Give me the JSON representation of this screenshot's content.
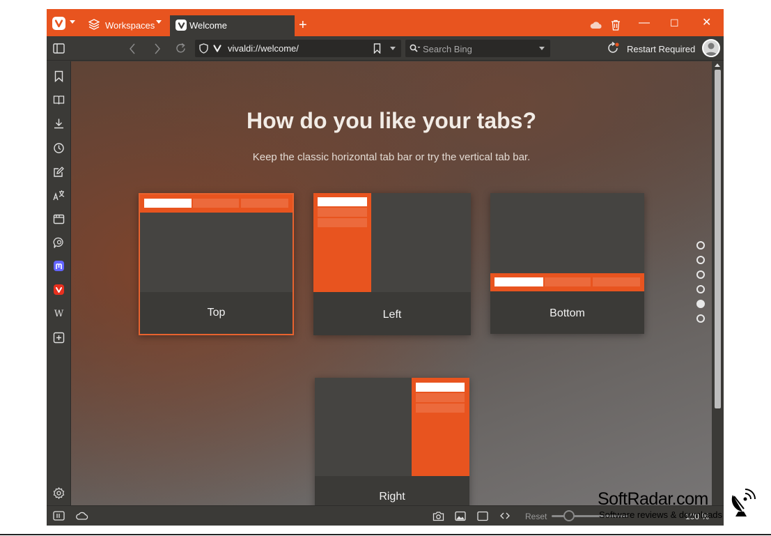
{
  "colors": {
    "accent": "#e8541f",
    "chrome": "#3b3a37",
    "tab_preview_white": "#ffffff"
  },
  "titlebar": {
    "workspaces_label": "Workspaces",
    "active_tab_label": "Welcome",
    "new_tab_symbol": "+",
    "controls": {
      "minimize": "—",
      "maximize": "☐",
      "close": "✕"
    }
  },
  "addressbar": {
    "url": "vivaldi://welcome/",
    "search_placeholder": "Search Bing",
    "restart_label": "Restart Required"
  },
  "sidepanel": {
    "icons": [
      "bookmark-icon",
      "reading-list-icon",
      "download-icon",
      "history-icon",
      "notes-icon",
      "translate-icon",
      "window-icon",
      "feed-icon",
      "mastodon-icon",
      "vivaldi-social-icon",
      "wikipedia-icon",
      "add-panel-icon"
    ],
    "wikipedia_glyph": "W"
  },
  "welcome": {
    "heading": "How do you like your tabs?",
    "subheading": "Keep the classic horizontal tab bar or try the vertical tab bar.",
    "options": [
      {
        "id": "top",
        "label": "Top",
        "selected": true
      },
      {
        "id": "left",
        "label": "Left",
        "selected": false
      },
      {
        "id": "bottom",
        "label": "Bottom",
        "selected": false
      },
      {
        "id": "right",
        "label": "Right",
        "selected": false
      }
    ],
    "steps_total": 6,
    "active_step": 5
  },
  "statusbar": {
    "reset_label": "Reset",
    "zoom_label": "100 %"
  },
  "watermark": {
    "title": "SoftRadar.com",
    "subtitle": "Software reviews & downloads"
  }
}
